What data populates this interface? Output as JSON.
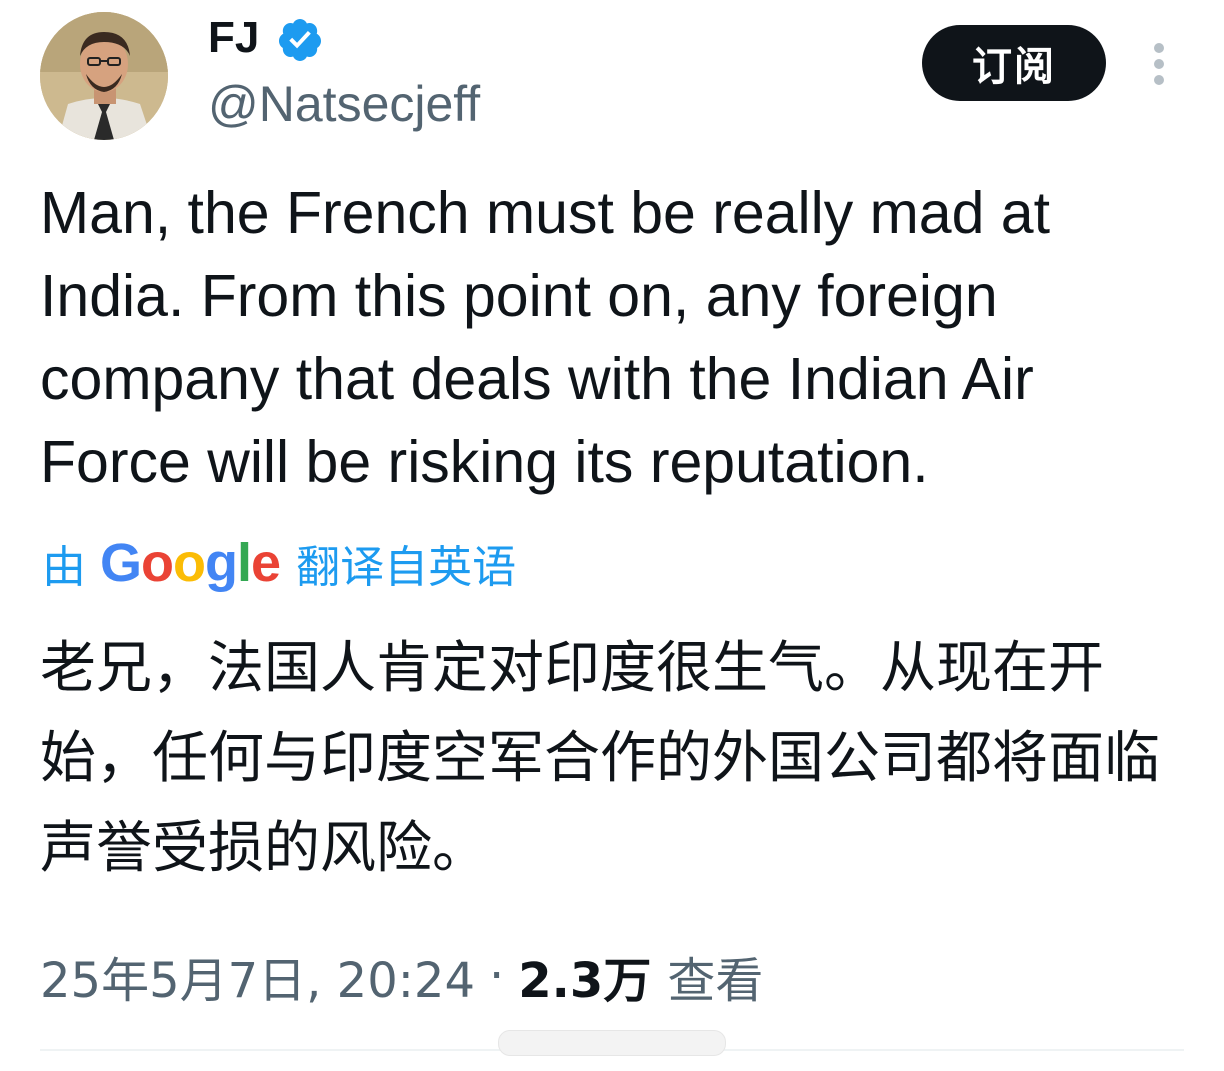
{
  "author": {
    "display_name": "FJ",
    "handle": "@Natsecjeff",
    "avatar_icon": "avatar-man-cartoon-icon",
    "verified_icon": "verified-badge-icon",
    "verified_color": "#1d9bf0"
  },
  "actions": {
    "subscribe_label": "订阅",
    "more_icon": "more-vertical-icon"
  },
  "tweet": {
    "text": "Man, the French must be really mad at India. From this point on, any foreign company that deals with the Indian Air Force will be risking its reputation."
  },
  "translation": {
    "prefix": "由",
    "logo_letters": [
      "G",
      "o",
      "o",
      "g",
      "l",
      "e"
    ],
    "suffix": "翻译自英语",
    "text": "老兄，法国人肯定对印度很生气。从现在开始，任何与印度空军合作的外国公司都将面临声誉受损的风险。"
  },
  "meta": {
    "timestamp": "25年5月7日, 20:24",
    "separator": "·",
    "views_count": "2.3万",
    "views_label": "查看"
  },
  "colors": {
    "text_primary": "#0f1419",
    "text_secondary": "#536471",
    "accent": "#1d9bf0",
    "button_bg": "#0f1419"
  }
}
